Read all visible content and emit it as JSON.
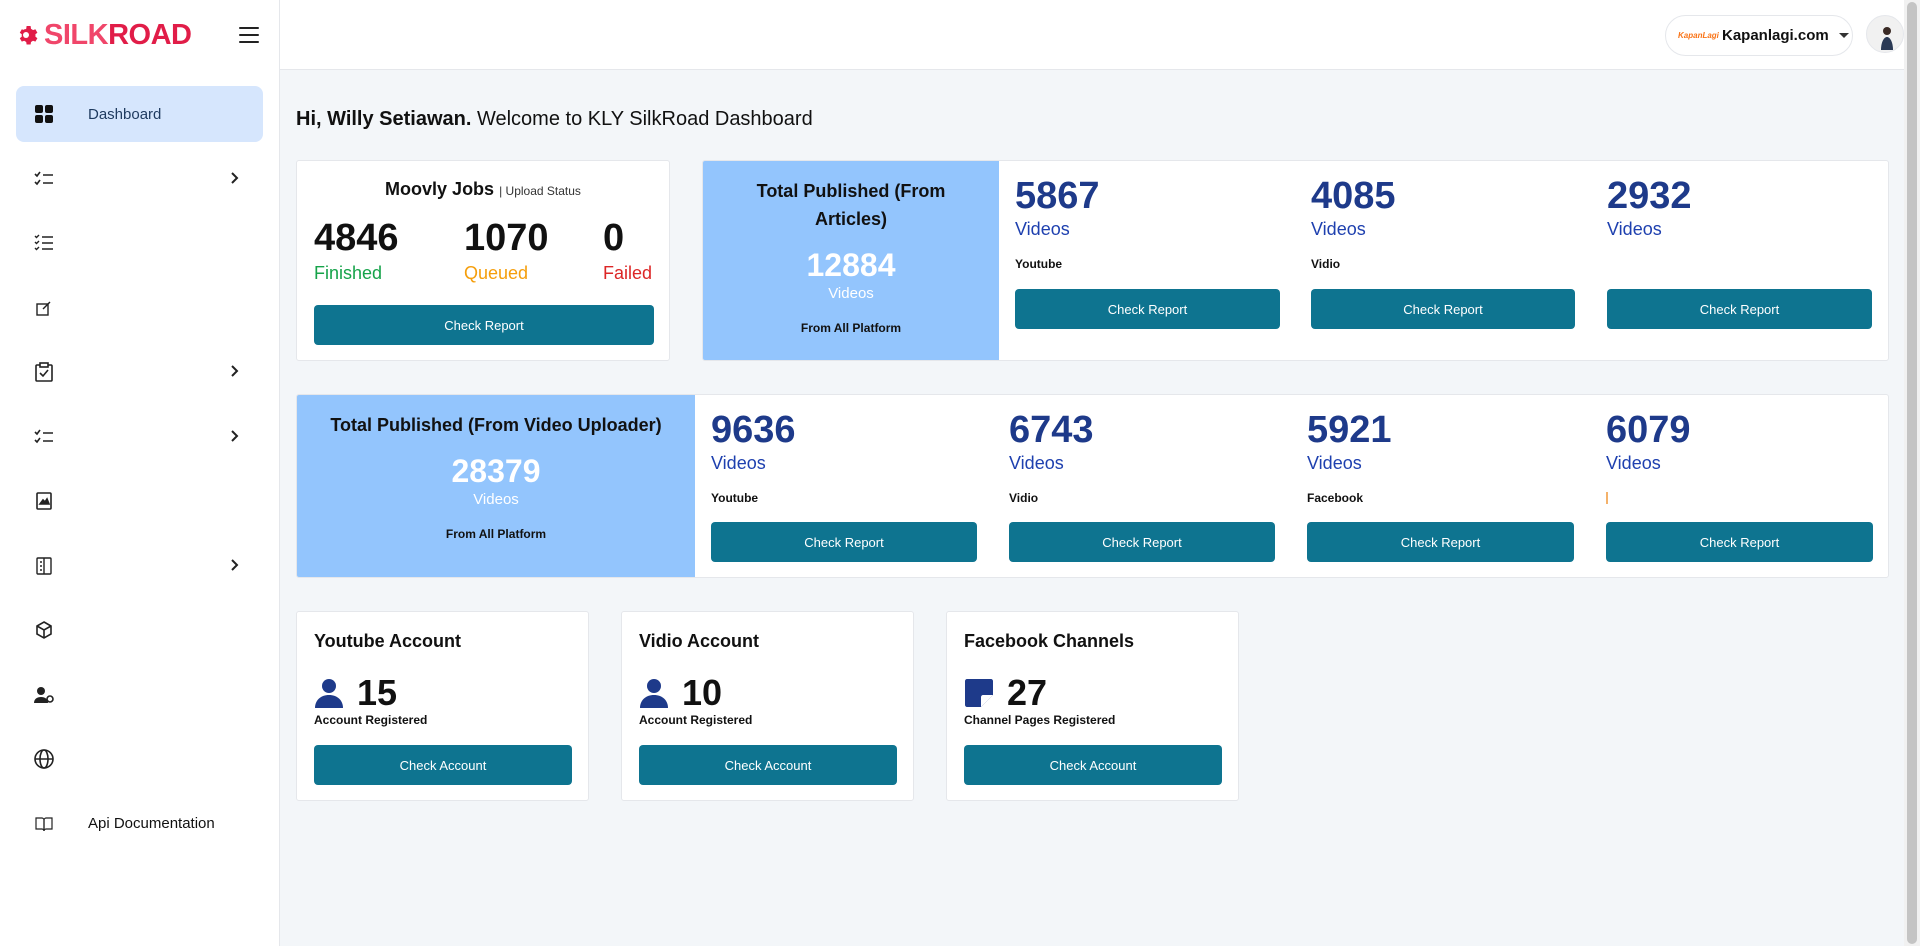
{
  "brand": {
    "logo_text_a": "SILK",
    "logo_text_b": "ROAD",
    "accent": "#e11d48"
  },
  "sidebar": {
    "items": [
      {
        "label": "Dashboard",
        "icon": "grid-icon",
        "active": true,
        "has_children": false
      },
      {
        "label": "",
        "icon": "checklist-icon",
        "active": false,
        "has_children": true
      },
      {
        "label": "",
        "icon": "list-check-icon",
        "active": false,
        "has_children": false
      },
      {
        "label": "",
        "icon": "edit-icon",
        "active": false,
        "has_children": false
      },
      {
        "label": "",
        "icon": "clipboard-check-icon",
        "active": false,
        "has_children": true
      },
      {
        "label": "",
        "icon": "checklist-icon",
        "active": false,
        "has_children": true
      },
      {
        "label": "",
        "icon": "image-book-icon",
        "active": false,
        "has_children": false
      },
      {
        "label": "",
        "icon": "document-list-icon",
        "active": false,
        "has_children": true
      },
      {
        "label": "",
        "icon": "cube-icon",
        "active": false,
        "has_children": false
      },
      {
        "label": "",
        "icon": "user-gear-icon",
        "active": false,
        "has_children": false
      },
      {
        "label": "",
        "icon": "globe-icon",
        "active": false,
        "has_children": false
      },
      {
        "label": "Api Documentation",
        "icon": "book-icon",
        "active": false,
        "has_children": false
      }
    ]
  },
  "topbar": {
    "site_logo": "KapanLagi",
    "site_name": "Kapanlagi.com"
  },
  "greeting": {
    "name": "Hi, Willy Setiawan.",
    "message": " Welcome to KLY SilkRoad Dashboard"
  },
  "moovly": {
    "title": "Moovly Jobs",
    "subtitle": "| Upload Status",
    "stats": [
      {
        "value": "4846",
        "label": "Finished",
        "color": "#16a34a"
      },
      {
        "value": "1070",
        "label": "Queued",
        "color": "#f59e0b"
      },
      {
        "value": "0",
        "label": "Failed",
        "color": "#dc2626"
      }
    ],
    "button": "Check Report"
  },
  "articles": {
    "title": "Total Published (From Articles)",
    "total": "12884",
    "unit": "Videos",
    "footer": "From All Platform",
    "platforms": [
      {
        "value": "5867",
        "unit": "Videos",
        "name": "Youtube",
        "button": "Check Report"
      },
      {
        "value": "4085",
        "unit": "Videos",
        "name": "Vidio",
        "button": "Check Report"
      },
      {
        "value": "2932",
        "unit": "Videos",
        "name": "",
        "button": "Check Report"
      }
    ]
  },
  "uploader": {
    "title": "Total Published (From Video Uploader)",
    "total": "28379",
    "unit": "Videos",
    "footer": "From All Platform",
    "platforms": [
      {
        "value": "9636",
        "unit": "Videos",
        "name": "Youtube",
        "button": "Check Report"
      },
      {
        "value": "6743",
        "unit": "Videos",
        "name": "Vidio",
        "button": "Check Report"
      },
      {
        "value": "5921",
        "unit": "Videos",
        "name": "Facebook",
        "button": "Check Report"
      },
      {
        "value": "6079",
        "unit": "Videos",
        "name": "",
        "button": "Check Report"
      }
    ]
  },
  "accounts": [
    {
      "title": "Youtube Account",
      "icon": "user-icon",
      "value": "15",
      "label": "Account Registered",
      "button": "Check Account"
    },
    {
      "title": "Vidio Account",
      "icon": "user-icon",
      "value": "10",
      "label": "Account Registered",
      "button": "Check Account"
    },
    {
      "title": "Facebook Channels",
      "icon": "sticky-note-icon",
      "value": "27",
      "label": "Channel Pages Registered",
      "button": "Check Account"
    }
  ]
}
